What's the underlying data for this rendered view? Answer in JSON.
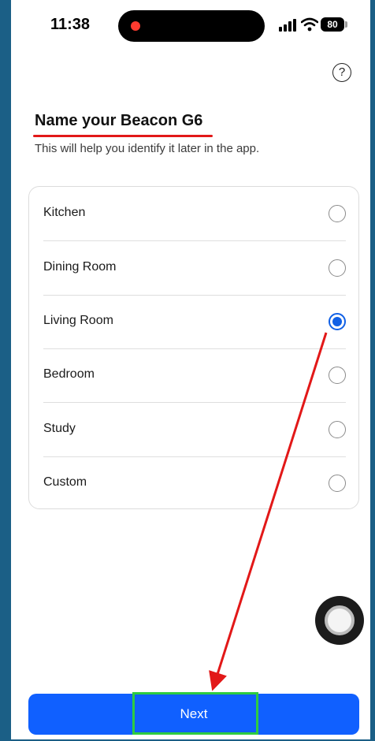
{
  "status_bar": {
    "time": "11:38",
    "battery": "80"
  },
  "help": {
    "glyph": "?"
  },
  "header": {
    "title": "Name your Beacon G6",
    "subtitle": "This will help you identify it later in the app."
  },
  "options": [
    {
      "label": "Kitchen",
      "selected": false
    },
    {
      "label": "Dining Room",
      "selected": false
    },
    {
      "label": "Living Room",
      "selected": true
    },
    {
      "label": "Bedroom",
      "selected": false
    },
    {
      "label": "Study",
      "selected": false
    },
    {
      "label": "Custom",
      "selected": false
    }
  ],
  "footer": {
    "next_label": "Next"
  },
  "colors": {
    "accent": "#1060ff",
    "annotation_red": "#e21818",
    "highlight_green": "#2ecc40",
    "frame": "#1b5f86"
  }
}
